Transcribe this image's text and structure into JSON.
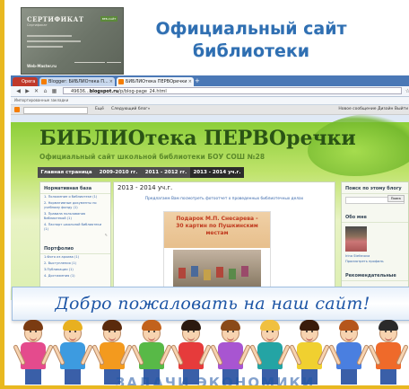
{
  "certificate": {
    "title": "СЕРТИФИКАТ",
    "subtitle": "Сертификат",
    "badge": "ВЕБ-САЙТ",
    "issuer": "Web-Master.ru"
  },
  "heading": {
    "line1": "Официальный сайт",
    "line2": "библиотеки"
  },
  "browser": {
    "tabs": [
      {
        "label": "Opera",
        "active": false
      },
      {
        "label": "Blogger: БИБЛИОтека П...",
        "active": false
      },
      {
        "label": "БИБЛИОтека ПЕРВОречки",
        "active": true
      }
    ],
    "new_tab": "+",
    "url_host": "blogspot.ru",
    "url_prefix": "49636...",
    "url_suffix": "/p/blog-page_24.html",
    "bookmarks_label": "Импортированные закладки"
  },
  "blogger_bar": {
    "more": "Ещё",
    "next_blog": "Следующий блог»",
    "right_text": "Новое сообщение  Дизайн  Выйти"
  },
  "blog": {
    "title": "БИБЛИОтека ПЕРВОречки",
    "description": "Официальный сайт школьной библиотеки БОУ СОШ №28",
    "menu": [
      {
        "label": "Главная страница",
        "active": false
      },
      {
        "label": "2009-2010 гг.",
        "active": false
      },
      {
        "label": "2011 - 2012 гг.",
        "active": false
      },
      {
        "label": "2013 - 2014 уч.г.",
        "active": true
      }
    ]
  },
  "left_widgets": [
    {
      "title": "Нормативная база",
      "links": [
        "1. Положение о библиотеке (1)",
        "2. Нормативные документы по учебному фонду (1)",
        "3. Правила пользования библиотекой (1)",
        "4. Паспорт школьной библиотеки (1)"
      ]
    },
    {
      "title": "Портфолио",
      "links": [
        "1.Фото из архива (1)",
        "2. Выступления (1)",
        "3.Публикации (1)",
        "4. Достижения (1)"
      ]
    }
  ],
  "center": {
    "page_title": "2013 - 2014 уч.г.",
    "note": "Предлагаем Вам посмотреть фотоотчет о проведенных библиотечных делах",
    "poster_line1": "Подарок М.П. Снесарева -",
    "poster_line2": "30 картин по Пушкинским местам"
  },
  "right_widgets": {
    "search_title": "Поиск по этому блогу",
    "search_button": "Поиск",
    "about_title": "Обо мне",
    "author": "Irina Stefanova",
    "profile_link": "Просмотреть профиль",
    "bottom_title": "Рекомендательные"
  },
  "banner": {
    "text": "Добро пожаловать на наш сайт!"
  },
  "bottom_text": "ЗАДАЧИ ЭКОНОМИКИ",
  "kids": [
    {
      "hair": "#7a3b12",
      "shirt": "#e44b8d"
    },
    {
      "hair": "#e8b020",
      "shirt": "#3d9be0"
    },
    {
      "hair": "#5a2a0c",
      "shirt": "#f39a1e"
    },
    {
      "hair": "#c2621c",
      "shirt": "#58b947"
    },
    {
      "hair": "#2b1a10",
      "shirt": "#e63b3b"
    },
    {
      "hair": "#8a4a18",
      "shirt": "#a855d1"
    },
    {
      "hair": "#f0c040",
      "shirt": "#24a4a4"
    },
    {
      "hair": "#3a1c0c",
      "shirt": "#f0d030"
    },
    {
      "hair": "#b5561c",
      "shirt": "#4a7fe0"
    },
    {
      "hair": "#2a2a2a",
      "shirt": "#ef6a2a"
    }
  ]
}
